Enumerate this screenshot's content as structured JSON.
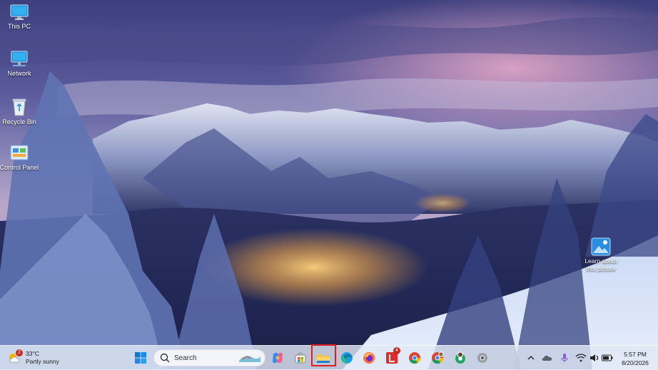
{
  "desktop": {
    "icons": [
      {
        "label": "This PC",
        "icon": "monitor-icon"
      },
      {
        "label": "Network",
        "icon": "network-icon"
      },
      {
        "label": "Recycle Bin",
        "icon": "recycle-bin-icon"
      },
      {
        "label": "Control Panel",
        "icon": "control-panel-icon"
      }
    ],
    "spotlight": {
      "label": "Learn about this picture",
      "icon": "picture-info-icon"
    }
  },
  "taskbar": {
    "weather": {
      "temp": "33°C",
      "condition": "Partly sunny",
      "icon": "partly-sunny-icon",
      "badge": "2"
    },
    "start": {
      "icon": "windows-start-icon"
    },
    "search": {
      "placeholder": "Search",
      "icon": "search-icon"
    },
    "apps": [
      {
        "name": "copilot",
        "icon": "copilot-icon"
      },
      {
        "name": "store",
        "icon": "microsoft-store-icon"
      },
      {
        "name": "file-explorer",
        "icon": "folder-icon",
        "highlighted": true
      },
      {
        "name": "edge",
        "icon": "edge-icon"
      },
      {
        "name": "firefox",
        "icon": "firefox-icon"
      },
      {
        "name": "libreoffice",
        "icon": "libreoffice-icon",
        "badge": "4"
      },
      {
        "name": "chrome",
        "icon": "chrome-icon"
      },
      {
        "name": "chrome-profile",
        "icon": "chrome-profile-icon"
      },
      {
        "name": "chrome-dev",
        "icon": "chrome-profile-icon"
      },
      {
        "name": "chrome-canary",
        "icon": "chrome-icon"
      }
    ],
    "tray": {
      "icons": [
        "chevron-up-icon",
        "onedrive-icon",
        "microphone-icon",
        "wifi-icon",
        "speaker-icon",
        "battery-icon"
      ]
    },
    "clock": {
      "time": "5:57 PM",
      "date": "8/20/2026"
    }
  },
  "colors": {
    "highlight": "#e0201f",
    "taskbar": "#e1e8f5"
  }
}
